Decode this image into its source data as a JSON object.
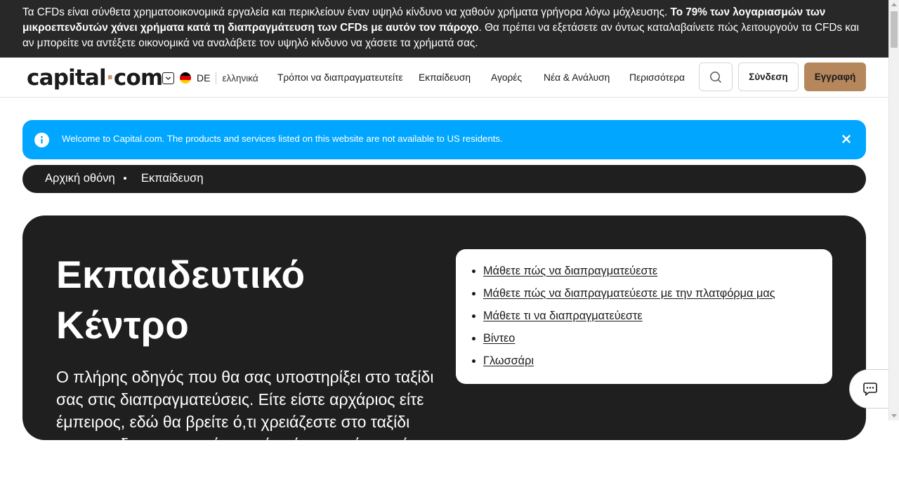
{
  "risk_warning": {
    "part1": "Τα CFDs είναι σύνθετα χρηματοοικονομικά εργαλεία και περικλείουν έναν υψηλό κίνδυνο να χαθούν χρήματα γρήγορα λόγω μόχλευσης. ",
    "bold": "Το 79% των λογαριασμών των μικροεπενδυτών χάνει χρήματα κατά τη διαπραγμάτευση των CFDs με αυτόν τον πάροχο",
    "part2": ". Θα πρέπει να εξετάσετε αν όντως καταλαβαίνετε πώς λειτουργούν τα CFDs και αν μπορείτε να αντέξετε οικονομικά να αναλάβετε τον υψηλό κίνδυνο να χάσετε τα χρήματά σας."
  },
  "header": {
    "logo_left": "capital",
    "logo_dot": "·",
    "logo_right": "com",
    "country": "DE",
    "language": "ελληνικά",
    "nav": [
      "Τρόποι να διαπραγματευτείτε",
      "Εκπαίδευση",
      "Αγορές",
      "Νέα & Ανάλυση",
      "Περισσότερα"
    ],
    "login": "Σύνδεση",
    "signup": "Εγγραφή"
  },
  "notice": {
    "text": "Welcome to Capital.com. The products and services listed on this website are not available to US residents."
  },
  "breadcrumb": [
    "Αρχική οθόνη",
    "Εκπαίδευση"
  ],
  "hero": {
    "title": "Εκπαιδευτικό Κέντρο",
    "description": "Ο πλήρης οδηγός που θα σας υποστηρίξει στο ταξίδι σας στις διαπραγματεύσεις. Είτε είστε αρχάριος είτε έμπειρος, εδώ θα βρείτε ό,τι χρειάζεστε στο ταξίδι σας στις διαπραγματεύσεις, είτε είστε αρχάριος είτε έμπειρος",
    "links": [
      "Μάθετε πώς να διαπραγματεύεστε",
      "Μάθετε πώς να διαπραγματεύεστε με την πλατφόρμα μας",
      "Μάθετε τι να διαπραγματεύεστε",
      "Βίντεο",
      "Γλωσσάρι"
    ]
  },
  "colors": {
    "risk_bg": "#282828",
    "accent": "#b6875c",
    "notice_bg": "#00a6ff",
    "dark": "#1f1f1f"
  },
  "icons": [
    "chevron-down-icon",
    "germany-flag-icon",
    "search-icon",
    "info-icon",
    "close-icon",
    "chat-icon"
  ]
}
